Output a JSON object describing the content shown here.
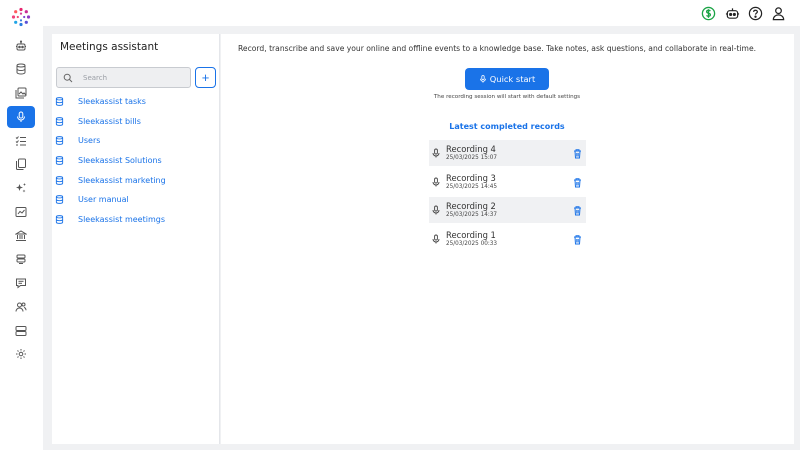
{
  "colors": {
    "accent": "#1a73e8",
    "rail_active": "#1a73e8",
    "credit_icon": "#1aa345"
  },
  "rail": {
    "logo_icon": "app-logo",
    "items": [
      {
        "name": "rail-robot-icon",
        "icon": "robot",
        "active": false
      },
      {
        "name": "rail-database-icon",
        "icon": "database",
        "active": false
      },
      {
        "name": "rail-gallery-icon",
        "icon": "gallery",
        "active": false
      },
      {
        "name": "rail-microphone-icon",
        "icon": "microphone",
        "active": true
      },
      {
        "name": "rail-checklist-icon",
        "icon": "checklist",
        "active": false
      },
      {
        "name": "rail-documents-icon",
        "icon": "documents",
        "active": false
      },
      {
        "name": "rail-sparkles-icon",
        "icon": "sparkles",
        "active": false
      },
      {
        "name": "rail-analytics-icon",
        "icon": "analytics",
        "active": false
      },
      {
        "name": "rail-institution-icon",
        "icon": "institution",
        "active": false
      },
      {
        "name": "rail-stack-icon",
        "icon": "stack",
        "active": false
      },
      {
        "name": "rail-chat-icon",
        "icon": "chat",
        "active": false
      },
      {
        "name": "rail-users-icon",
        "icon": "users",
        "active": false
      },
      {
        "name": "rail-servers-icon",
        "icon": "servers",
        "active": false
      },
      {
        "name": "rail-settings-icon",
        "icon": "settings",
        "active": false
      }
    ]
  },
  "topbar": {
    "icons": [
      "dollar-icon",
      "robot-icon",
      "help-icon",
      "user-icon"
    ]
  },
  "sidebar": {
    "title": "Meetings assistant",
    "search_placeholder": "Search",
    "add_label": "+",
    "items": [
      {
        "label": "Sleekassist tasks"
      },
      {
        "label": "Sleekassist bills"
      },
      {
        "label": "Users"
      },
      {
        "label": "Sleekassist Solutions"
      },
      {
        "label": "Sleekassist marketing"
      },
      {
        "label": "User manual"
      },
      {
        "label": "Sleekassist meetimgs"
      }
    ]
  },
  "main": {
    "intro": "Record, transcribe and save your online and offline events to a knowledge base. Take notes, ask questions, and collaborate in real-time.",
    "quick_start_label": "Quick start",
    "quick_start_note": "The recording session will start with default settings",
    "latest_title": "Latest completed records",
    "records": [
      {
        "name": "Recording 4",
        "date": "25/03/2025 15:07"
      },
      {
        "name": "Recording 3",
        "date": "25/03/2025 14:45"
      },
      {
        "name": "Recording 2",
        "date": "25/03/2025 14:37"
      },
      {
        "name": "Recording 1",
        "date": "25/03/2025 00:33"
      }
    ]
  }
}
